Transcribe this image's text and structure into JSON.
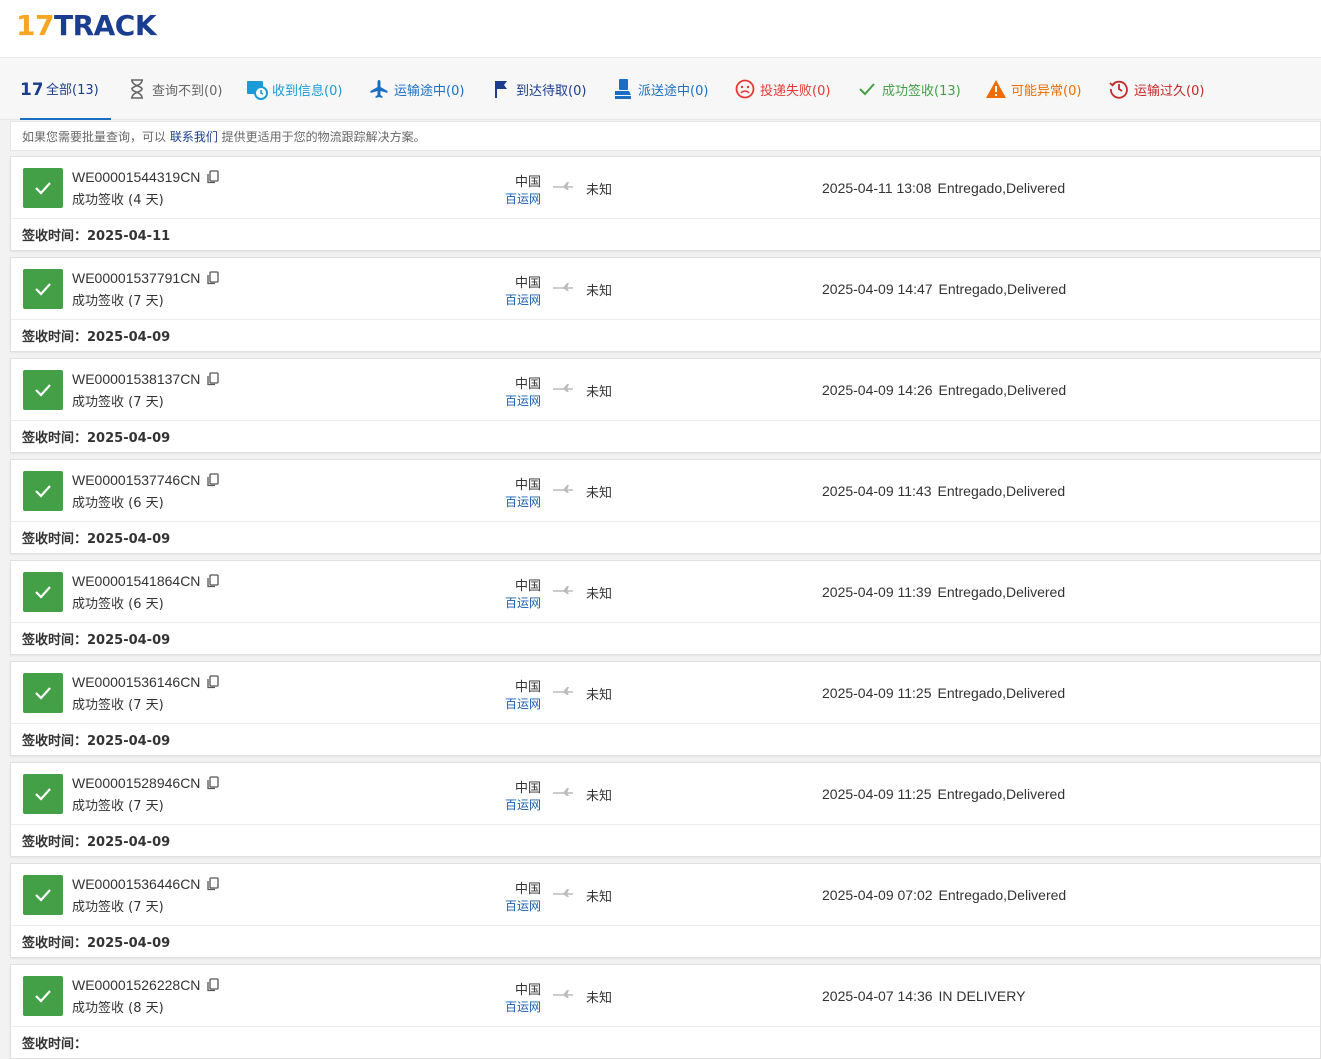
{
  "logo": {
    "num": "17",
    "word": "TRACK"
  },
  "tabs": [
    {
      "label": "全部(13)",
      "color": "#1a3d8f",
      "icon": "17track-icon",
      "active": true
    },
    {
      "label": "查询不到(0)",
      "color": "#666666",
      "icon": "hourglass-icon"
    },
    {
      "label": "收到信息(0)",
      "color": "#1a9bd7",
      "icon": "info-received-icon"
    },
    {
      "label": "运输途中(0)",
      "color": "#1a6fc4",
      "icon": "plane-icon"
    },
    {
      "label": "到达待取(0)",
      "color": "#1a3d8f",
      "icon": "flag-icon"
    },
    {
      "label": "派送途中(0)",
      "color": "#1a6fc4",
      "icon": "delivery-person-icon"
    },
    {
      "label": "投递失败(0)",
      "color": "#e53935",
      "icon": "sad-face-icon"
    },
    {
      "label": "成功签收(13)",
      "color": "#43a047",
      "icon": "checkmark-icon"
    },
    {
      "label": "可能异常(0)",
      "color": "#ef6c00",
      "icon": "warning-icon"
    },
    {
      "label": "运输过久(0)",
      "color": "#c62828",
      "icon": "clock-history-icon"
    }
  ],
  "notice": {
    "prefix": "如果您需要批量查询，可以 ",
    "link": "联系我们",
    "suffix": " 提供更适用于您的物流跟踪解决方案。"
  },
  "received_label": "签收时间：",
  "packages": [
    {
      "number": "WE00001544319CN",
      "status": "成功签收 (4 天)",
      "origin": "中国",
      "carrier": "百运网",
      "dest": "未知",
      "time": "2025-04-11 13:08",
      "event": "Entregado,Delivered",
      "received": "2025-04-11"
    },
    {
      "number": "WE00001537791CN",
      "status": "成功签收 (7 天)",
      "origin": "中国",
      "carrier": "百运网",
      "dest": "未知",
      "time": "2025-04-09 14:47",
      "event": "Entregado,Delivered",
      "received": "2025-04-09"
    },
    {
      "number": "WE00001538137CN",
      "status": "成功签收 (7 天)",
      "origin": "中国",
      "carrier": "百运网",
      "dest": "未知",
      "time": "2025-04-09 14:26",
      "event": "Entregado,Delivered",
      "received": "2025-04-09"
    },
    {
      "number": "WE00001537746CN",
      "status": "成功签收 (6 天)",
      "origin": "中国",
      "carrier": "百运网",
      "dest": "未知",
      "time": "2025-04-09 11:43",
      "event": "Entregado,Delivered",
      "received": "2025-04-09"
    },
    {
      "number": "WE00001541864CN",
      "status": "成功签收 (6 天)",
      "origin": "中国",
      "carrier": "百运网",
      "dest": "未知",
      "time": "2025-04-09 11:39",
      "event": "Entregado,Delivered",
      "received": "2025-04-09"
    },
    {
      "number": "WE00001536146CN",
      "status": "成功签收 (7 天)",
      "origin": "中国",
      "carrier": "百运网",
      "dest": "未知",
      "time": "2025-04-09 11:25",
      "event": "Entregado,Delivered",
      "received": "2025-04-09"
    },
    {
      "number": "WE00001528946CN",
      "status": "成功签收 (7 天)",
      "origin": "中国",
      "carrier": "百运网",
      "dest": "未知",
      "time": "2025-04-09 11:25",
      "event": "Entregado,Delivered",
      "received": "2025-04-09"
    },
    {
      "number": "WE00001536446CN",
      "status": "成功签收 (7 天)",
      "origin": "中国",
      "carrier": "百运网",
      "dest": "未知",
      "time": "2025-04-09 07:02",
      "event": "Entregado,Delivered",
      "received": "2025-04-09"
    },
    {
      "number": "WE00001526228CN",
      "status": "成功签收 (8 天)",
      "origin": "中国",
      "carrier": "百运网",
      "dest": "未知",
      "time": "2025-04-07 14:36",
      "event": "IN DELIVERY",
      "received": ""
    }
  ]
}
